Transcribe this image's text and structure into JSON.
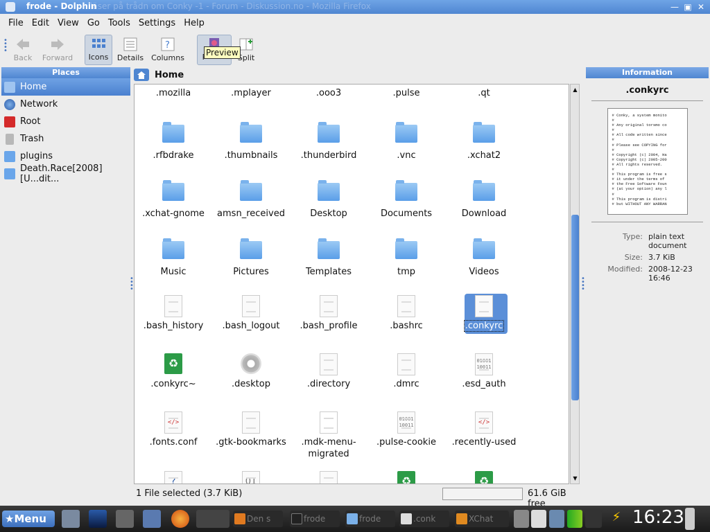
{
  "window": {
    "title": "frode - Dolphin",
    "ghost_title": "läser på trådn om Conky -1 - Forum - Diskussion.no - Mozilla Firefox"
  },
  "menubar": [
    "File",
    "Edit",
    "View",
    "Go",
    "Tools",
    "Settings",
    "Help"
  ],
  "toolbar": {
    "back": "Back",
    "forward": "Forward",
    "icons": "Icons",
    "details": "Details",
    "columns": "Columns",
    "preview": "P",
    "split": "Split",
    "tooltip": "Preview"
  },
  "places": {
    "title": "Places",
    "items": [
      "Home",
      "Network",
      "Root",
      "Trash",
      "plugins",
      "Death.Race[2008][U...dit..."
    ]
  },
  "location": "Home",
  "files": [
    ".mozilla",
    ".mplayer",
    ".ooo3",
    ".pulse",
    ".qt",
    ".rfbdrake",
    ".thumbnails",
    ".thunderbird",
    ".vnc",
    ".xchat2",
    ".xchat-gnome",
    "amsn_received",
    "Desktop",
    "Documents",
    "Download",
    "Music",
    "Pictures",
    "Templates",
    "tmp",
    "Videos",
    ".bash_history",
    ".bash_logout",
    ".bash_profile",
    ".bashrc",
    ".conkyrc",
    ".conkyrc~",
    ".desktop",
    ".directory",
    ".dmrc",
    ".esd_auth",
    ".fonts.conf",
    ".gtk-bookmarks",
    ".mdk-menu-migrated",
    ".pulse-cookie",
    ".recently-used"
  ],
  "status": {
    "selection": "1 File selected (3.7 KiB)",
    "free": "61.6 GiB free"
  },
  "info": {
    "title": "Information",
    "name": ".conkyrc",
    "type_label": "Type:",
    "type": "plain text document",
    "size_label": "Size:",
    "size": "3.7 KiB",
    "modified_label": "Modified:",
    "modified": "2008-12-23 16:46",
    "preview": "# Conky, a system monito\n#\n# Any original torsmo co\n#\n# All code written since\n#\n# Please see COPYING for\n#\n# Copyright (c) 2004, Ha\n# Copyright (c) 2005-200\n# All rights reserved.\n#\n# This program is free s\n# it under the terms of\n# the Free Software Foun\n# (at your option) any l\n#\n# This program is distri\n# but WITHOUT ANY WARRAN"
  },
  "taskbar": {
    "menu": "Menu",
    "tasks": [
      "Den s",
      "frode",
      "frode",
      ".conk",
      "XChat"
    ],
    "clock": "16:23"
  }
}
